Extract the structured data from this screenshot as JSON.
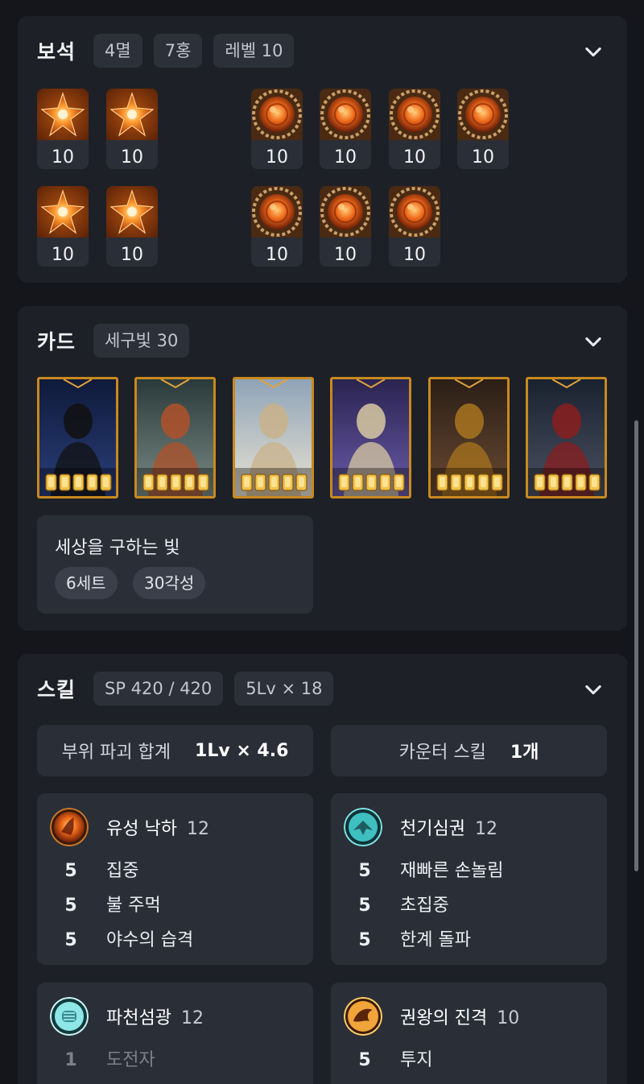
{
  "gems": {
    "title": "보석",
    "chips": [
      "4멸",
      "7홍",
      "레벨 10"
    ],
    "items": [
      {
        "type": "멸",
        "level": "10"
      },
      {
        "type": "멸",
        "level": "10"
      },
      {
        "type": "홍",
        "level": "10"
      },
      {
        "type": "홍",
        "level": "10"
      },
      {
        "type": "홍",
        "level": "10"
      },
      {
        "type": "홍",
        "level": "10"
      },
      {
        "type": "멸",
        "level": "10"
      },
      {
        "type": "멸",
        "level": "10"
      },
      {
        "type": "홍",
        "level": "10"
      },
      {
        "type": "홍",
        "level": "10"
      },
      {
        "type": "홍",
        "level": "10"
      }
    ]
  },
  "cards": {
    "title": "카드",
    "chips": [
      "세구빛 30"
    ],
    "set_name": "세상을 구하는 빛",
    "set_pills": [
      "6세트",
      "30각성"
    ],
    "awakening_each": 5,
    "count": 6
  },
  "skills": {
    "title": "스킬",
    "chips": [
      "SP 420 / 420",
      "5Lv × 18"
    ],
    "summary": [
      {
        "label": "부위 파괴 합계",
        "value": "1Lv × 4.6"
      },
      {
        "label": "카운터 스킬",
        "value": "1개"
      }
    ],
    "list": [
      {
        "name": "유성 낙하",
        "level": "12",
        "icon": "meteor-fall-icon",
        "tripods": [
          {
            "lv": "5",
            "name": "집중"
          },
          {
            "lv": "5",
            "name": "불 주먹"
          },
          {
            "lv": "5",
            "name": "야수의 습격"
          }
        ]
      },
      {
        "name": "천기심권",
        "level": "12",
        "icon": "heavenly-fist-icon",
        "tripods": [
          {
            "lv": "5",
            "name": "재빠른 손놀림"
          },
          {
            "lv": "5",
            "name": "초집중"
          },
          {
            "lv": "5",
            "name": "한계 돌파"
          }
        ]
      },
      {
        "name": "파천섬광",
        "level": "12",
        "icon": "flash-fist-icon",
        "tripods": [
          {
            "lv": "1",
            "name": "도전자"
          }
        ]
      },
      {
        "name": "권왕의 진격",
        "level": "10",
        "icon": "fist-king-icon",
        "tripods": [
          {
            "lv": "5",
            "name": "투지"
          }
        ]
      }
    ]
  },
  "colors": {
    "panel": "#1d2027",
    "chip": "#2c3039",
    "card_border": "#c8891f"
  }
}
